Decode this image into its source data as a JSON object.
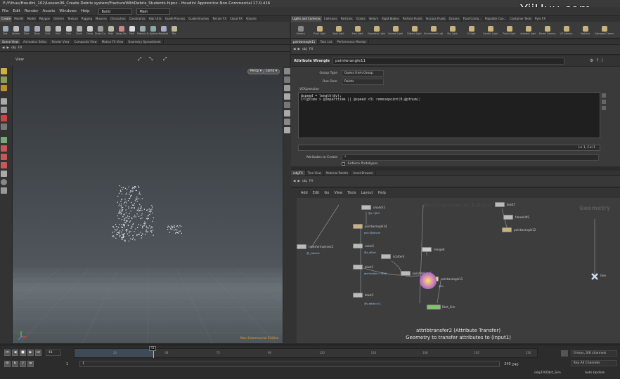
{
  "window": {
    "title": "P:/Yiihuu/Houdini_102/Lesson06_Create Debris system/FractureWithDebris_Students.hipnc - Houdini Apprentice Non-Commercial 17.0.416"
  },
  "watermark": "YiiHuu.com",
  "menu": {
    "items": [
      "File",
      "Edit",
      "Render",
      "Assets",
      "Windows",
      "Help"
    ],
    "desktop": "Build",
    "context": "Main"
  },
  "left_shelf": {
    "tabs": [
      "Create",
      "Modify",
      "Model",
      "Polygon",
      "Deform",
      "Texture",
      "Rigging",
      "Muscles",
      "Characters",
      "Constraints",
      "Hair Utils",
      "Guide Process",
      "Guide Brushes",
      "Terrain FX",
      "Cloud FX",
      "Volume"
    ],
    "tools": [
      "Box",
      "Sphere",
      "Tube",
      "Torus",
      "Grid",
      "Null",
      "Line",
      "Circle",
      "Curve",
      "Draw Curve",
      "Path",
      "Spray Paint",
      "Font",
      "Platonic Solids",
      "L-System",
      "Metaball",
      "File"
    ]
  },
  "right_shelf": {
    "tabs": [
      "Lights and Cameras",
      "Collisions",
      "Particles",
      "Grains",
      "Vellum",
      "Rigid Bodies",
      "Particle Fluids",
      "Viscous Fluids",
      "Oceans",
      "Fluid Conta...",
      "Populate Con...",
      "Container Tools",
      "Pyro FX"
    ],
    "tools": [
      "Camera",
      "Point Light",
      "Spot Light",
      "Area Light",
      "Geometry Light",
      "Volume Light",
      "Distant Light",
      "Environment Light",
      "Sky Light",
      "GI Light",
      "Caustic Light",
      "Portal Light",
      "Ambient Light",
      "Stereo Camera",
      "VR Camera",
      "Switcher",
      "Gamepad Camera"
    ]
  },
  "scene_tabs": [
    "Scene View",
    "Animation Editor",
    "Render View",
    "Composite View",
    "Motion FX View",
    "Geometry Spreadsheet"
  ],
  "viewport": {
    "path": [
      "obj",
      "FX"
    ],
    "label": "View",
    "persp": "Persp",
    "cam": "cam1",
    "badge": "Non-Commercial Edition"
  },
  "param_tabs": [
    "pointwrangle11",
    "Take List",
    "Performance Monitor"
  ],
  "params": {
    "path": [
      "obj",
      "FX"
    ],
    "node_type": "Attribute Wrangle",
    "node_name": "pointwrangle11",
    "group_type_label": "Group Type",
    "group_type_value": "Guess from Group",
    "run_over_label": "Run Over",
    "run_over_value": "Points",
    "vex_label": "VEXpression",
    "code_line1": "@speed = length(@v);",
    "code_line2": "if(@Time > @impacttime || @speed <3) removepoint(0,@ptnum);",
    "cursor": "Ln 1, Col 1",
    "attr_create_label": "Attributes to Create",
    "attr_create_value": "*",
    "enforce_label": "Enforce Prototypes"
  },
  "network_tabs": [
    "/obj/FX",
    "Tree View",
    "Material Palette",
    "Asset Browser"
  ],
  "network": {
    "path": [
      "obj",
      "FX"
    ],
    "menu": [
      "Add",
      "Edit",
      "Go",
      "View",
      "Tools",
      "Layout",
      "Help"
    ],
    "watermark": "Non-Commercial Edition",
    "context_label": "Geometry",
    "nodes": [
      "unpack1",
      "pointwrangle14",
      "noise1",
      "blast1",
      "blast3",
      "transformpieces2",
      "scatter4",
      "pointdeform1",
      "pointwrangle11",
      "merge6",
      "Dbrt_Sim",
      "blast7",
      "timeshift1",
      "pointwrangle12",
      "Geo"
    ],
    "node_notes": [
      "@v / @v2",
      "pnt=@ptnum",
      "@x_offset",
      "pts.fraction > @v2",
      "@v attrib=0.1",
      "@i_volume",
      "@id"
    ],
    "tooltip_title": "attribtransfer2 (Attribute Transfer)",
    "tooltip_desc": "Geometry to transfer attributes to (input1)"
  },
  "timeline": {
    "frame": "41",
    "ticks": [
      "24",
      "48",
      "72",
      "96",
      "120",
      "144",
      "168",
      "192",
      "216"
    ],
    "start": "1",
    "start2": "1",
    "end": "240",
    "end2": "240",
    "keys": "0 keys, 0/0 channels",
    "key_all": "Key All Channels",
    "status_path": "/obj/FX/Dbrt_Sim",
    "auto_update": "Auto Update",
    "progress": 0.17
  },
  "colors": {
    "accent": "#e2a33a",
    "selected": "#f0d65a",
    "node_green": "#7fc46a"
  }
}
